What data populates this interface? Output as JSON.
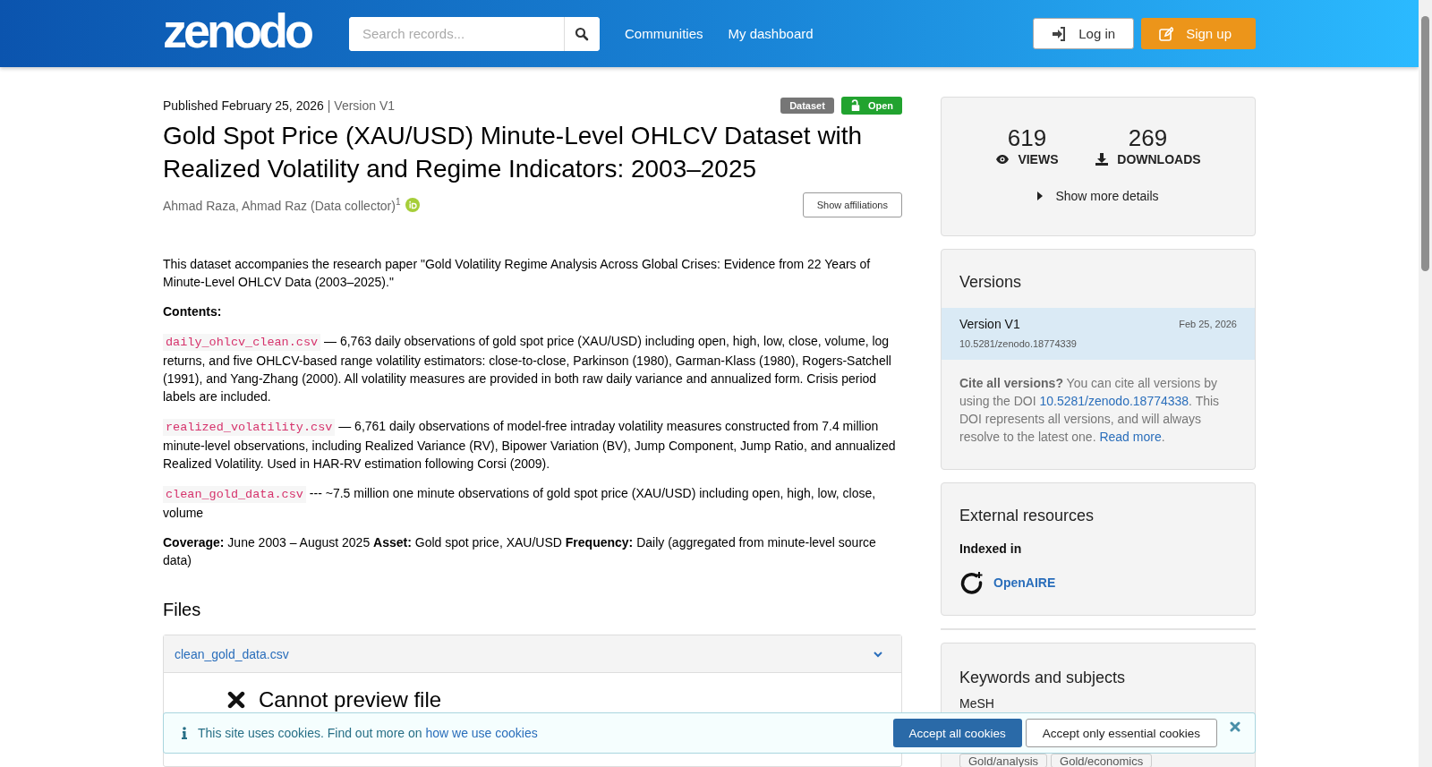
{
  "header": {
    "logo": "zenodo",
    "search": {
      "placeholder": "Search records..."
    },
    "nav": [
      "Communities",
      "My dashboard"
    ],
    "buttons": [
      {
        "label": "Log in",
        "kind": "login"
      },
      {
        "label": "Sign up",
        "kind": "signup"
      }
    ]
  },
  "record": {
    "published": "Published February 25, 2026",
    "version": "| Version V1",
    "badges": [
      {
        "label": "Dataset",
        "kind": "type"
      },
      {
        "label": "Open",
        "kind": "access"
      }
    ],
    "title": "Gold Spot Price (XAU/USD) Minute-Level OHLCV Dataset with Realized Volatility and Regime Indicators: 2003–2025",
    "creators": "Ahmad Raza, Ahmad Raz (Data collector)$^{1}$",
    "orcid": true,
    "affiliations_button": "Show affiliations",
    "description": [
      {
        "kind": "para",
        "text": "This dataset accompanies the research paper \"Gold Volatility Regime Analysis Across Global Crises: Evidence from 22 Years of Minute-Level OHLCV Data (2003–2025).\""
      },
      {
        "kind": "heading",
        "text": "Contents:"
      },
      {
        "kind": "file",
        "code": "daily_ohlcv_clean.csv",
        "text": " — 6,763 daily observations of gold spot price (XAU/USD) including open, high, low, close, volume, log returns, and five OHLCV-based range volatility estimators: close-to-close, Parkinson (1980), Garman-Klass (1980), Rogers-Satchell (1991), and Yang-Zhang (2000). All volatility measures are provided in both raw daily variance and annualized form. Crisis period labels are included."
      },
      {
        "kind": "file",
        "code": "realized_volatility.csv",
        "text": " — 6,761 daily observations of model-free intraday volatility measures constructed from 7.4 million minute-level observations, including Realized Variance (RV), Bipower Variation (BV), Jump Component, Jump Ratio, and annualized Realized Volatility. Used in HAR-RV estimation following Corsi (2009)."
      },
      {
        "kind": "file",
        "code": "clean_gold_data.csv",
        "text": " --- ~7.5 million one minute observations of gold spot price (XAU/USD) including open, high, low, close, volume"
      },
      {
        "kind": "para",
        "text": "**Coverage:** June 2003 – August 2025 **Asset:** Gold spot price, XAU/USD **Frequency:** Daily (aggregated from minute-level source data)"
      }
    ],
    "files": {
      "heading": "Files",
      "items": [
        {
          "name": "clean_gold_data.csv",
          "expanded": true,
          "preview": "Cannot preview file"
        }
      ]
    }
  },
  "sidebar": {
    "stats": [
      {
        "value": "619",
        "label": "VIEWS",
        "kind": "views"
      },
      {
        "value": "269",
        "label": "DOWNLOADS",
        "kind": "downloads"
      }
    ],
    "details_toggle": "Show more details",
    "versions": {
      "title": "Versions",
      "items": [
        {
          "label": "Version V1",
          "date": "Feb 25, 2026",
          "doi": "10.5281/zenodo.18774339",
          "selected": true
        }
      ],
      "cite": [
        {
          "kind": "text",
          "text": "**Cite all versions?** You can cite all versions by using the DOI "
        },
        {
          "kind": "link",
          "text": "10.5281/zenodo.18774338"
        },
        {
          "kind": "text",
          "text": ". This DOI represents all versions, and will always resolve to the latest one. "
        },
        {
          "kind": "link",
          "text": "Read more"
        },
        {
          "kind": "text",
          "text": "."
        }
      ]
    },
    "external": {
      "title": "External resources",
      "subtitle": "Indexed in",
      "items": [
        {
          "label": "OpenAIRE"
        }
      ]
    },
    "keywords": {
      "title": "Keywords and subjects",
      "scheme": "MeSH",
      "tags": [
        "Gold/analysis",
        "Gold/economics"
      ]
    }
  },
  "cookie_banner": {
    "text": "This site uses cookies. Find out more on ",
    "link": "how we use cookies",
    "buttons": [
      {
        "label": "Accept all cookies",
        "kind": "primary"
      },
      {
        "label": "Accept only essential cookies",
        "kind": "secondary"
      }
    ]
  }
}
